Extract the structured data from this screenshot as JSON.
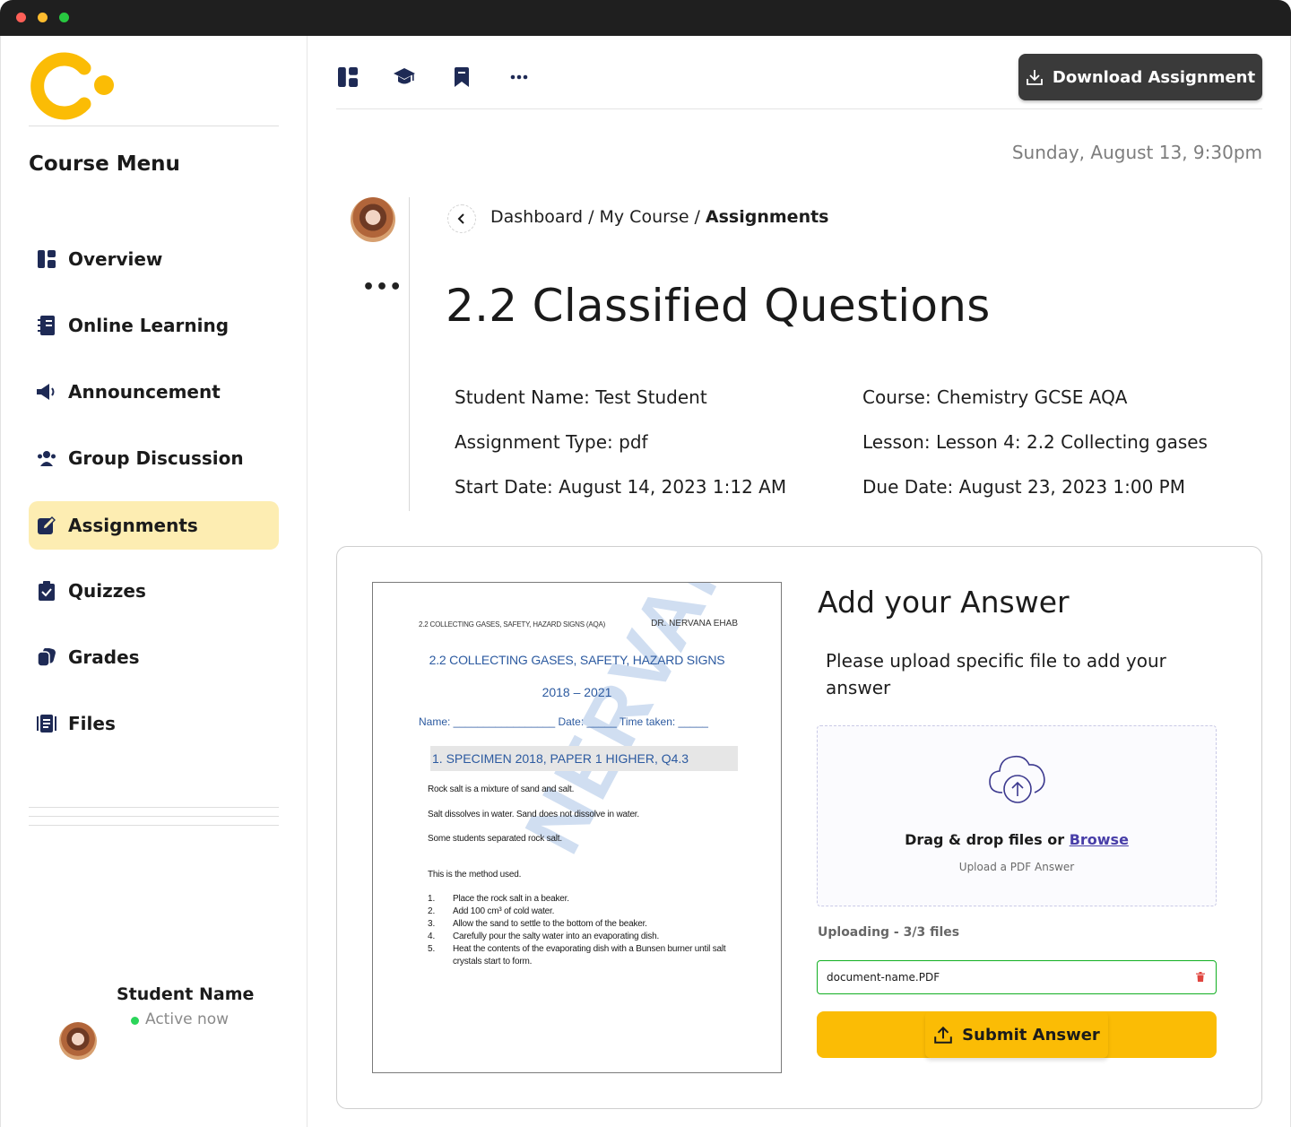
{
  "sidebar": {
    "menu_title": "Course Menu",
    "items": [
      {
        "label": "Overview",
        "icon": "dashboard-icon"
      },
      {
        "label": "Online Learning",
        "icon": "notebook-icon"
      },
      {
        "label": "Announcement",
        "icon": "megaphone-icon"
      },
      {
        "label": "Group Discussion",
        "icon": "group-icon"
      },
      {
        "label": "Assignments",
        "icon": "edit-icon",
        "active": true
      },
      {
        "label": "Quizzes",
        "icon": "clipboard-check-icon"
      },
      {
        "label": "Grades",
        "icon": "grades-icon"
      },
      {
        "label": "Files",
        "icon": "files-icon"
      }
    ],
    "profile": {
      "name": "Student Name",
      "status": "Active now"
    }
  },
  "toolbar": {
    "icons": [
      "dashboard-icon",
      "graduation-cap-icon",
      "bookmark-icon",
      "more-icon"
    ],
    "download_label": "Download Assignment"
  },
  "header": {
    "date": "Sunday, August 13, 9:30pm",
    "breadcrumb": [
      "Dashboard",
      "My Course",
      "Assignments"
    ],
    "title": "2.2 Classified Questions"
  },
  "details": {
    "student_name": "Student Name: Test Student",
    "assignment_type": "Assignment Type: pdf",
    "start_date": "Start Date: August 14, 2023 1:12 AM",
    "course": "Course: Chemistry GCSE AQA",
    "lesson": "Lesson: Lesson 4: 2.2 Collecting gases",
    "due_date": "Due Date: August 23, 2023 1:00 PM"
  },
  "document": {
    "header_left": "2.2 COLLECTING GASES, SAFETY, HAZARD SIGNS (AQA)",
    "header_right": "DR. NERVANA EHAB",
    "title": "2.2 COLLECTING GASES, SAFETY, HAZARD SIGNS",
    "years": "2018 – 2021",
    "name_row": "Name: _________________ Date: _____ Time taken: _____",
    "specimen": "1.  SPECIMEN 2018, PAPER 1 HIGHER, Q4.3",
    "lines": [
      "Rock salt is a mixture of sand and salt.",
      "Salt dissolves in water.  Sand does not dissolve in water.",
      "Some students separated rock salt.",
      "This is the method used."
    ],
    "steps": [
      {
        "n": "1.",
        "text": "Place the rock salt in a beaker."
      },
      {
        "n": "2.",
        "text": "Add 100 cm³ of cold water."
      },
      {
        "n": "3.",
        "text": "Allow the sand to settle to the bottom of the beaker."
      },
      {
        "n": "4.",
        "text": "Carefully pour the salty water into an evaporating dish."
      },
      {
        "n": "5.",
        "text": "Heat the contents of the evaporating dish with a Bunsen burner until salt"
      },
      {
        "n": "",
        "text": "crystals start to form."
      }
    ],
    "watermark": "NERVANA EHAB"
  },
  "answer": {
    "title": "Add your Answer",
    "description": "Please upload specific file to add your answer",
    "drop_text": "Drag & drop files or",
    "browse_label": "Browse",
    "drop_sub": "Upload a PDF Answer",
    "upload_status": "Uploading - 3/3 files",
    "file_name": "document-name.PDF",
    "submit_label": "Submit Answer"
  },
  "colors": {
    "accent": "#fbbc05",
    "active_bg": "#fdedb2",
    "icon_navy": "#1e2a55",
    "link": "#483ea8",
    "file_border": "#11af22"
  }
}
